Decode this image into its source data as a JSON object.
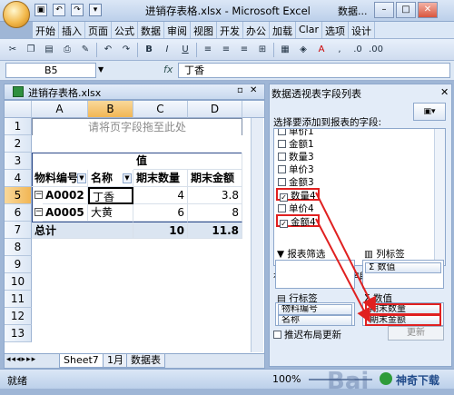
{
  "window": {
    "title": "进销存表格.xlsx - Microsoft Excel",
    "side_title": "数据..."
  },
  "menu": [
    "开始",
    "插入",
    "页面",
    "公式",
    "数据",
    "审阅",
    "视图",
    "开发",
    "办公",
    "加载",
    "Clar",
    "选项",
    "设计"
  ],
  "formula": {
    "name_box": "B5",
    "fx": "fx",
    "value": "丁香"
  },
  "workbook": {
    "title": "进销存表格.xlsx"
  },
  "columns": [
    "A",
    "B",
    "C",
    "D"
  ],
  "rows": [
    "1",
    "2",
    "3",
    "4",
    "5",
    "6",
    "7",
    "8",
    "9",
    "10",
    "11",
    "12",
    "13"
  ],
  "pivot": {
    "page_drop": "请将页字段拖至此处",
    "values_header": "值",
    "headers": [
      "物料编号",
      "名称",
      "期末数量",
      "期末金额"
    ],
    "data": [
      {
        "code": "A0002",
        "name": "丁香",
        "qty": "4",
        "amt": "3.8"
      },
      {
        "code": "A0005",
        "name": "大黄",
        "qty": "6",
        "amt": "8"
      }
    ],
    "total": {
      "label": "总计",
      "qty": "10",
      "amt": "11.8"
    }
  },
  "sheet_tabs": [
    "Sheet7",
    "1月",
    "数据表"
  ],
  "status": {
    "text": "就绪",
    "zoom": "100%"
  },
  "panel": {
    "title": "数据透视表字段列表",
    "prompt": "选择要添加到报表的字段:",
    "fields": [
      {
        "label": "单价1",
        "checked": false
      },
      {
        "label": "金额1",
        "checked": false
      },
      {
        "label": "数量3",
        "checked": false
      },
      {
        "label": "单价3",
        "checked": false
      },
      {
        "label": "金额3",
        "checked": false
      },
      {
        "label": "数量4",
        "checked": true
      },
      {
        "label": "单价4",
        "checked": false
      },
      {
        "label": "金额4",
        "checked": true
      }
    ],
    "drag_text": "在以下区域间拖动字段:",
    "report_filter": "报表筛选",
    "col_label": "列标签",
    "col_item": "Σ 数值",
    "row_label": "行标签",
    "values_label": "Σ 数值",
    "row_items": [
      "物料编号",
      "名称"
    ],
    "value_items": [
      "期末数量",
      "期末金额"
    ],
    "defer": "推迟布局更新",
    "update": "更新"
  },
  "watermark": "Bai",
  "brand": "神奇下载",
  "colors": {
    "accent_red": "#e02020",
    "pivot_border": "#2d4a8a",
    "selected_header": "#f2b654"
  }
}
